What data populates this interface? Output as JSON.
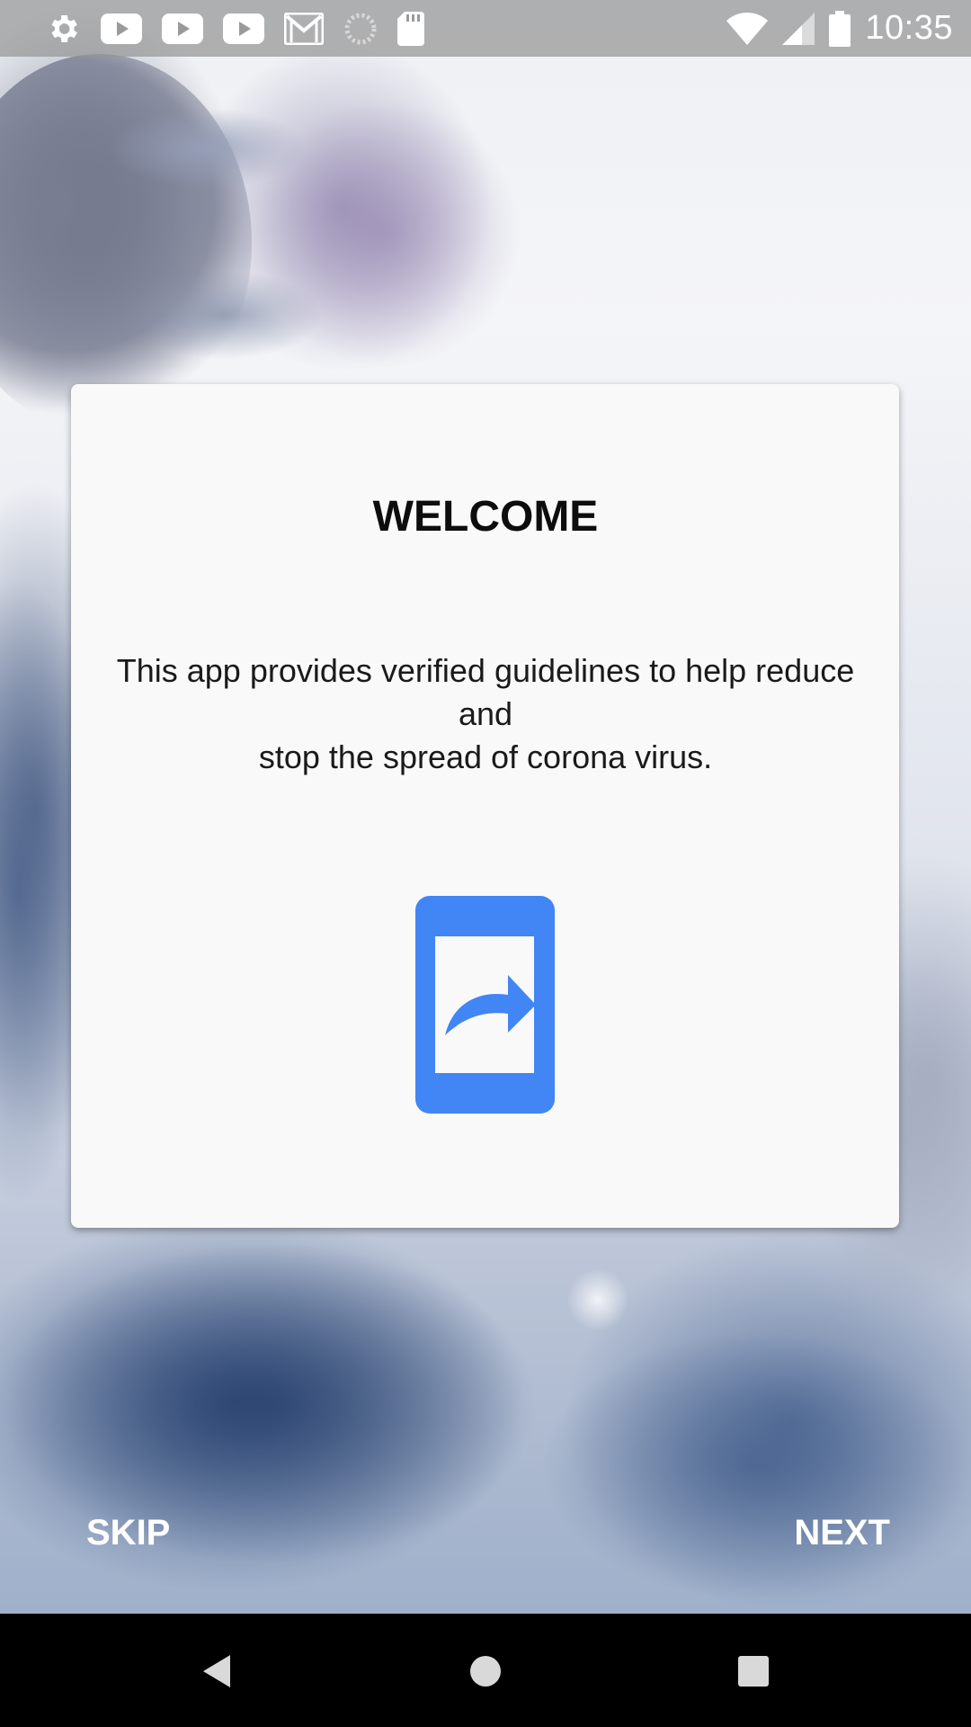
{
  "status_bar": {
    "time": "10:35",
    "left_icons": [
      "settings-icon",
      "youtube-icon",
      "youtube-icon",
      "youtube-icon",
      "gmail-icon",
      "loading-icon",
      "sd-card-icon"
    ],
    "right_icons": [
      "wifi-icon",
      "signal-icon",
      "battery-icon"
    ]
  },
  "card": {
    "title": "WELCOME",
    "description_lines": [
      "This app provides verified guidelines to help reduce",
      "and",
      "stop the spread of corona virus."
    ],
    "icon": "phone-share-icon",
    "icon_color": "#4285f4"
  },
  "footer": {
    "skip_label": "SKIP",
    "next_label": "NEXT"
  },
  "nav_bar": {
    "buttons": [
      "back-icon",
      "home-icon",
      "recents-icon"
    ]
  }
}
